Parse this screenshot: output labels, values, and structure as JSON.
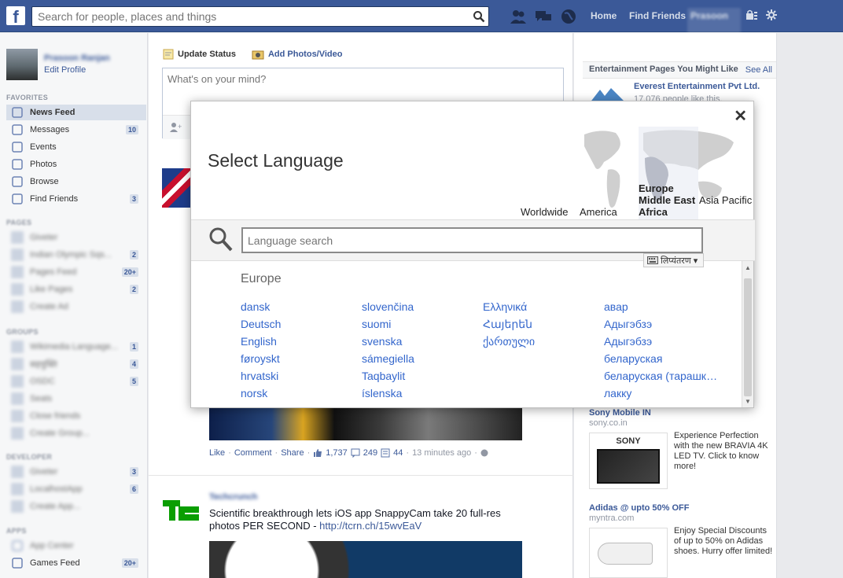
{
  "topbar": {
    "search_placeholder": "Search for people, places and things",
    "home_label": "Home",
    "find_friends_label": "Find Friends",
    "profile_name": "Prasoon"
  },
  "left": {
    "profile_name": "Prasoon Ranjan",
    "edit_profile": "Edit Profile",
    "favorites_head": "FAVORITES",
    "favorites": [
      {
        "label": "News Feed",
        "count": ""
      },
      {
        "label": "Messages",
        "count": "10"
      },
      {
        "label": "Events",
        "count": ""
      },
      {
        "label": "Photos",
        "count": ""
      },
      {
        "label": "Browse",
        "count": ""
      },
      {
        "label": "Find Friends",
        "count": "3"
      }
    ],
    "pages_head": "PAGES",
    "pages": [
      {
        "label": "Giveter",
        "count": ""
      },
      {
        "label": "Indian Olympic Sqs...",
        "count": "2"
      },
      {
        "label": "Pages Feed",
        "count": "20+"
      },
      {
        "label": "Like Pages",
        "count": "2"
      },
      {
        "label": "Create Ad",
        "count": ""
      }
    ],
    "groups_head": "GROUPS",
    "groups": [
      {
        "label": "Wikimedia Language...",
        "count": "1"
      },
      {
        "label": "सहयुक्ति",
        "count": "4"
      },
      {
        "label": "OSDC",
        "count": "5"
      },
      {
        "label": "Seats",
        "count": ""
      },
      {
        "label": "Close friends",
        "count": ""
      },
      {
        "label": "Create Group...",
        "count": ""
      }
    ],
    "developer_head": "DEVELOPER",
    "developer": [
      {
        "label": "Giveter",
        "count": "3"
      },
      {
        "label": "LocalhostApp",
        "count": "6"
      },
      {
        "label": "Create App...",
        "count": ""
      }
    ],
    "apps_head": "APPS",
    "apps": [
      {
        "label": "App Center",
        "count": ""
      },
      {
        "label": "Games Feed",
        "count": "20+"
      }
    ]
  },
  "composer": {
    "update_status": "Update Status",
    "add_photos": "Add Photos/Video",
    "placeholder": "What's on your mind?"
  },
  "post1": {
    "like": "Like",
    "comment": "Comment",
    "share": "Share",
    "likes": "1,737",
    "comments": "249",
    "shares": "44",
    "time": "13 minutes ago"
  },
  "post2": {
    "author": "Techcrunch",
    "text": "Scientific breakthrough lets iOS app SnappyCam take 20 full-res photos PER SECOND - ",
    "link": "http://tcrn.ch/15wvEaV"
  },
  "right": {
    "ent_head": "Entertainment Pages You Might Like",
    "see_all": "See All",
    "everest_name": "Everest Entertainment Pvt Ltd.",
    "everest_likes": "17,076 people like this.",
    "sony_title": "Sony Mobile IN",
    "sony_domain": "sony.co.in",
    "sony_text": "Experience Perfection with the new BRAVIA 4K LED TV. Click to know more!",
    "adidas_title": "Adidas @ upto 50% OFF",
    "adidas_domain": "myntra.com",
    "adidas_text": "Enjoy Special Discounts of up to 50% on Adidas shoes. Hurry offer limited!"
  },
  "modal": {
    "title": "Select Language",
    "close": "✕",
    "regions": {
      "worldwide": "Worldwide",
      "america": "America",
      "emea": "Europe Middle East Africa",
      "asia": "Asia Pacific"
    },
    "search_placeholder": "Language search",
    "translit_label": "लिप्यंतरण",
    "section_head": "Europe",
    "columns": [
      [
        "dansk",
        "Deutsch",
        "English",
        "føroyskt",
        "hrvatski",
        "norsk"
      ],
      [
        "slovenčina",
        "suomi",
        "svenska",
        "sámegiella",
        "Taqbaylit",
        "íslenska"
      ],
      [
        "Ελληνικά",
        "Հայերեն",
        "ქართული"
      ],
      [
        "авар",
        "Адыгэбзэ",
        "Адыгэбзэ",
        "беларуская",
        "беларуская (тарашкевіца)",
        "лакку"
      ]
    ]
  },
  "colors": {
    "fb_blue": "#3b5998",
    "link_blue": "#3366cc",
    "topbar": "#3b5998"
  }
}
